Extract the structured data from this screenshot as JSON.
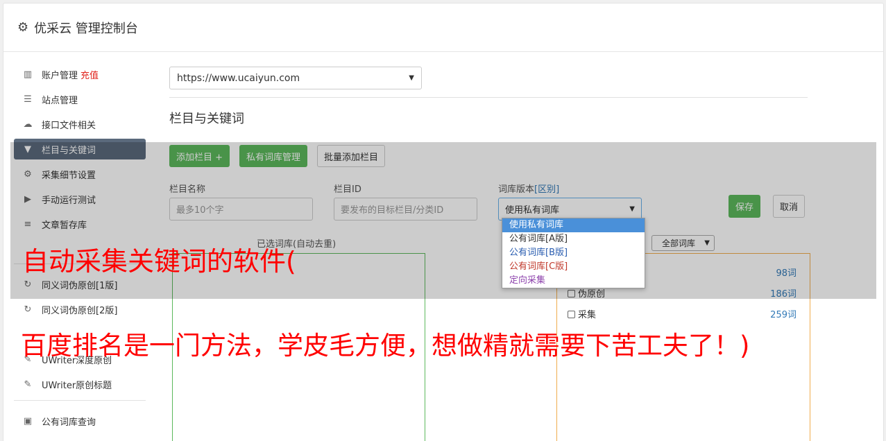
{
  "header": {
    "title": "优采云 管理控制台",
    "icon": "gear-icon"
  },
  "sidebar": {
    "items": [
      {
        "label": "账户管理",
        "badge": "充值",
        "icon": "bar-chart-icon"
      },
      {
        "label": "站点管理",
        "icon": "server-icon"
      },
      {
        "label": "接口文件相关",
        "icon": "cloud-upload-icon"
      },
      {
        "label": "栏目与关键词",
        "icon": "filter-icon",
        "active": true
      },
      {
        "label": "采集细节设置",
        "icon": "cogs-icon"
      },
      {
        "label": "手动运行测试",
        "icon": "play-icon"
      },
      {
        "label": "文章暂存库",
        "icon": "database-icon"
      },
      {
        "label": "同义词伪原创[1版]",
        "icon": "refresh-icon"
      },
      {
        "label": "同义词伪原创[2版]",
        "icon": "refresh-icon"
      },
      {
        "label": "UWriter深度原创",
        "icon": "edit-icon"
      },
      {
        "label": "UWriter原创标题",
        "icon": "edit-icon"
      },
      {
        "label": "公有词库查询",
        "icon": "book-icon"
      }
    ]
  },
  "main": {
    "site_url": "https://www.ucaiyun.com",
    "section_title": "栏目与关键词",
    "buttons": {
      "add_column": "添加栏目 +",
      "private_lib": "私有词库管理",
      "batch_add": "批量添加栏目"
    },
    "fields": {
      "name_label": "栏目名称",
      "name_placeholder": "最多10个字",
      "id_label": "栏目ID",
      "id_placeholder": "要发布的目标栏目/分类ID",
      "version_label": "词库版本",
      "version_hint": "[区别]",
      "version_value": "使用私有词库"
    },
    "save": "保存",
    "cancel": "取消",
    "dropdown_options": [
      "使用私有词库",
      "公有词库[A版]",
      "公有词库[B版]",
      "公有词库[C版]",
      "定向采集"
    ],
    "selected_label": "已选词库(自动去重)",
    "filter_value": "全部词库",
    "libraries": [
      {
        "name": "",
        "count": "98词"
      },
      {
        "name": "伪原创",
        "count": "186词"
      },
      {
        "name": "采集",
        "count": "259词"
      }
    ]
  },
  "watermark": {
    "line1": "自动采集关键词的软件(",
    "line2": "百度排名是一门方法，学皮毛方便，想做精就需要下苦工夫了！)"
  },
  "colors": {
    "accent_green": "#5cb85c",
    "active_nav": "#5b6a7c",
    "watermark_red": "#ff0000",
    "link_blue": "#337ab7"
  }
}
